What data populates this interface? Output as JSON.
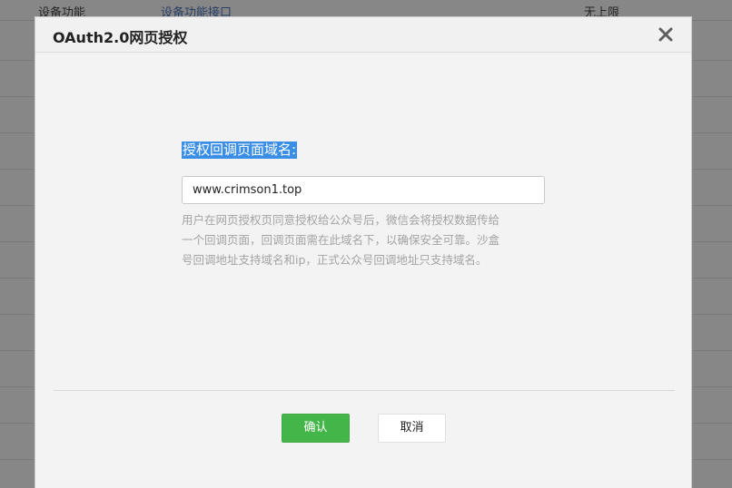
{
  "background": {
    "columns": [
      "设备功能",
      "设备功能接口",
      "无上限"
    ]
  },
  "dialog": {
    "title": "OAuth2.0网页授权",
    "close_icon": "close-icon",
    "field_label": "授权回调页面域名:",
    "field_value": "www.crimson1.top",
    "help_lines": [
      "用户在网页授权页同意授权给公众号后，微信会将授权数据传给",
      "一个回调页面，回调页面需在此域名下，以确保安全可靠。沙盒",
      "号回调地址支持域名和ip，正式公众号回调地址只支持域名。"
    ],
    "confirm_label": "确认",
    "cancel_label": "取消"
  },
  "colors": {
    "confirm_button": "#44b549",
    "label_highlight": "#3a8ee6"
  }
}
